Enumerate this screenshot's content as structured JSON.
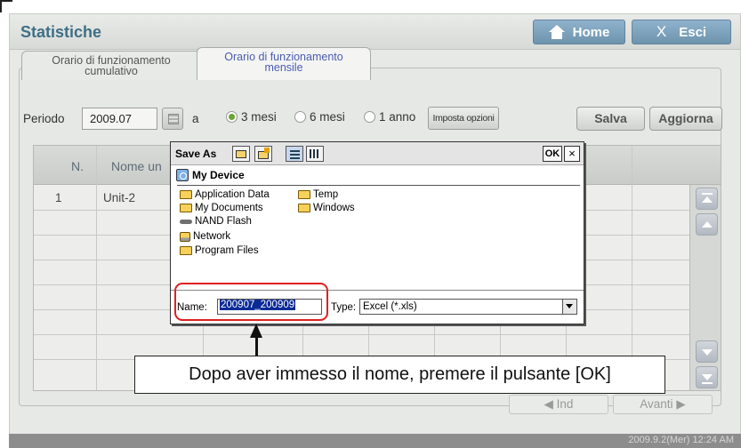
{
  "app": {
    "title": "Statistiche",
    "home_label": "Home",
    "exit_label": "Esci"
  },
  "tabs": [
    {
      "line1": "Orario di funzionamento",
      "line2": "cumulativo",
      "active": false
    },
    {
      "line1": "Orario di funzionamento",
      "line2": "mensile",
      "active": true
    }
  ],
  "filters": {
    "period_label": "Periodo",
    "period_value": "2009.07",
    "to_label": "a",
    "range_options": [
      {
        "label": "3 mesi",
        "selected": true
      },
      {
        "label": "6 mesi",
        "selected": false
      },
      {
        "label": "1 anno",
        "selected": false
      }
    ],
    "options_button": "Imposta opzioni",
    "save_button": "Salva",
    "refresh_button": "Aggiorna"
  },
  "table": {
    "headers": [
      "N.",
      "Nome un"
    ],
    "rows": [
      {
        "n": "1",
        "name": "Unit-2"
      }
    ]
  },
  "pager": {
    "prev_label": "Ind",
    "next_label": "Avanti"
  },
  "status": {
    "datetime": "2009.9.2(Mer)  12:24 AM"
  },
  "dialog": {
    "title": "Save As",
    "ok_label": "OK",
    "close_label": "×",
    "location": "My Device",
    "files_col1": [
      {
        "name": "Application Data",
        "icon": "folder-icon"
      },
      {
        "name": "My Documents",
        "icon": "folder-icon"
      },
      {
        "name": "NAND Flash",
        "icon": "drive-icon"
      },
      {
        "name": "Network",
        "icon": "network-icon"
      },
      {
        "name": "Program Files",
        "icon": "folder-icon"
      }
    ],
    "files_col2": [
      {
        "name": "Temp",
        "icon": "folder-icon"
      },
      {
        "name": "Windows",
        "icon": "folder-icon"
      }
    ],
    "name_label": "Name:",
    "name_value": "200907_200909",
    "type_label": "Type:",
    "type_value": "Excel (*.xls)"
  },
  "annotation": {
    "callout": "Dopo aver immesso il nome, premere il pulsante [OK]",
    "highlight_color": "#e02020"
  },
  "colors": {
    "title_blue": "#3f6f86",
    "button_blue": "#7ea3bd",
    "radio_green": "#6aa533",
    "active_tab_text": "#4b5bb0"
  }
}
